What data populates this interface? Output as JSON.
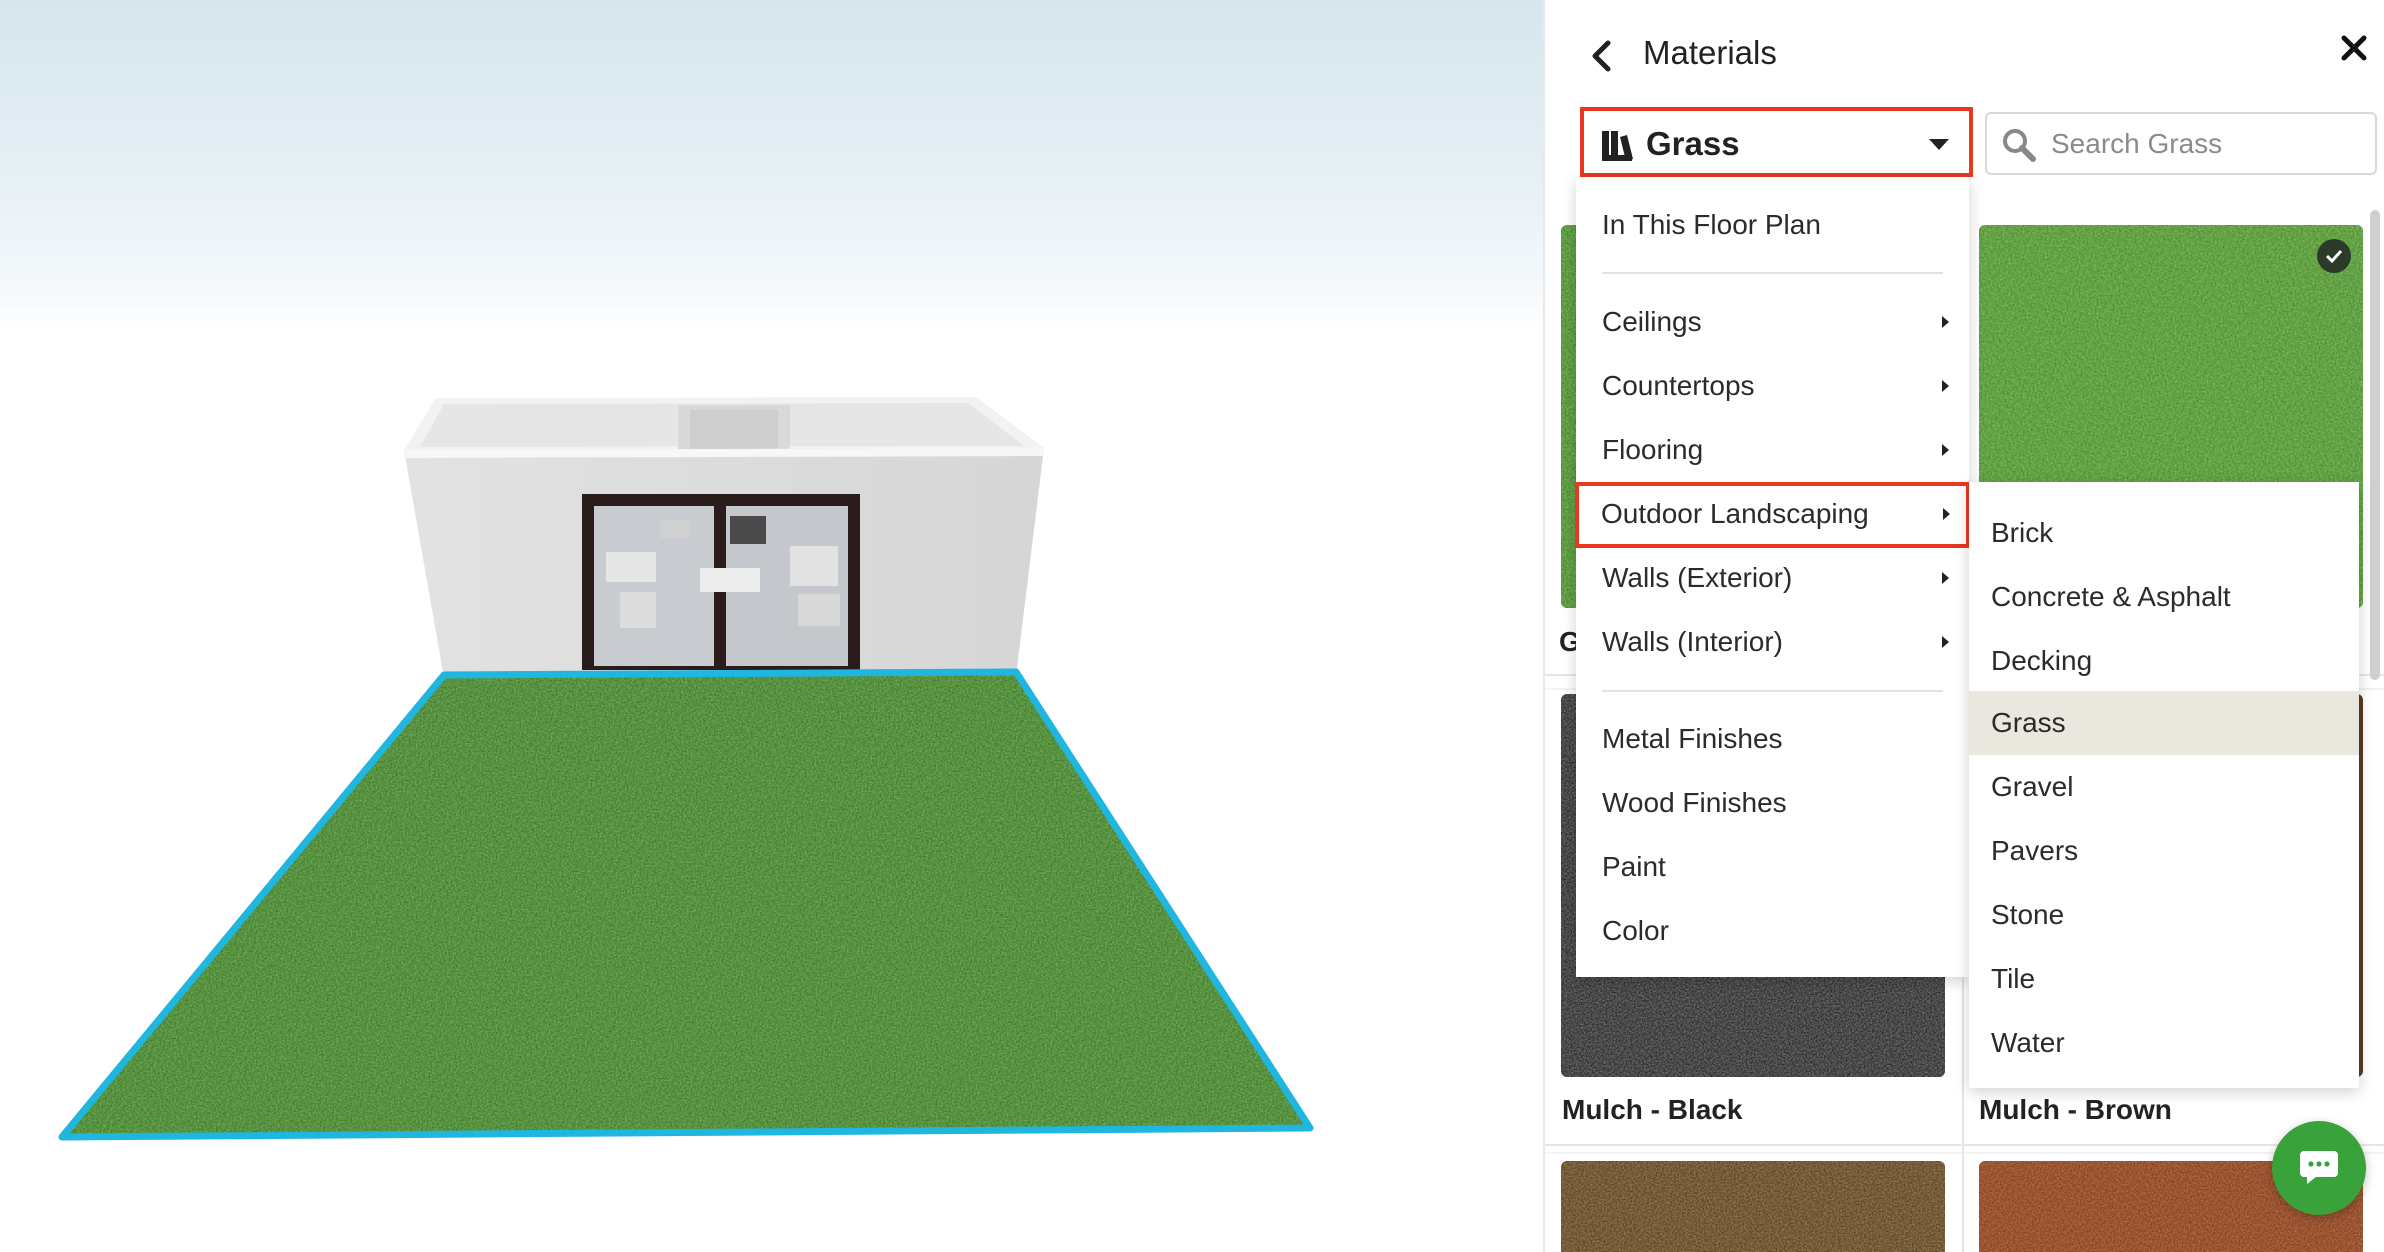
{
  "panel": {
    "title": "Materials",
    "back_icon": "chevron-left-icon",
    "close_icon": "close-icon",
    "category_select": {
      "value": "Grass",
      "icon": "book-icon"
    },
    "search": {
      "placeholder": "Search Grass",
      "value": ""
    }
  },
  "menu": {
    "top_item": "In This Floor Plan",
    "groups": [
      {
        "label": "Ceilings",
        "has_submenu": true
      },
      {
        "label": "Countertops",
        "has_submenu": true
      },
      {
        "label": "Flooring",
        "has_submenu": true
      },
      {
        "label": "Outdoor Landscaping",
        "has_submenu": true,
        "highlighted": true
      },
      {
        "label": "Walls (Exterior)",
        "has_submenu": true
      },
      {
        "label": "Walls (Interior)",
        "has_submenu": true
      }
    ],
    "finishes": [
      "Metal Finishes",
      "Wood Finishes",
      "Paint",
      "Color"
    ]
  },
  "submenu": {
    "items": [
      "Brick",
      "Concrete & Asphalt",
      "Decking",
      "Grass",
      "Gravel",
      "Pavers",
      "Stone",
      "Tile",
      "Water"
    ],
    "selected": "Grass"
  },
  "materials": {
    "tiles": [
      {
        "label": "G",
        "texture": "grass",
        "selected": false
      },
      {
        "label": "",
        "texture": "grass",
        "selected": true
      },
      {
        "label": "Mulch - Black",
        "texture": "mulch-black",
        "selected": false
      },
      {
        "label": "Mulch - Brown",
        "texture": "mulch-brown",
        "selected": false
      }
    ]
  },
  "colors": {
    "highlight_border": "#e8391f",
    "lawn_outline": "#1fb6e0",
    "grass": "#4a8a2e",
    "chat_button": "#3aa23a",
    "active_row": "#e9e7de"
  },
  "chat_icon": "chat-bubble-icon"
}
